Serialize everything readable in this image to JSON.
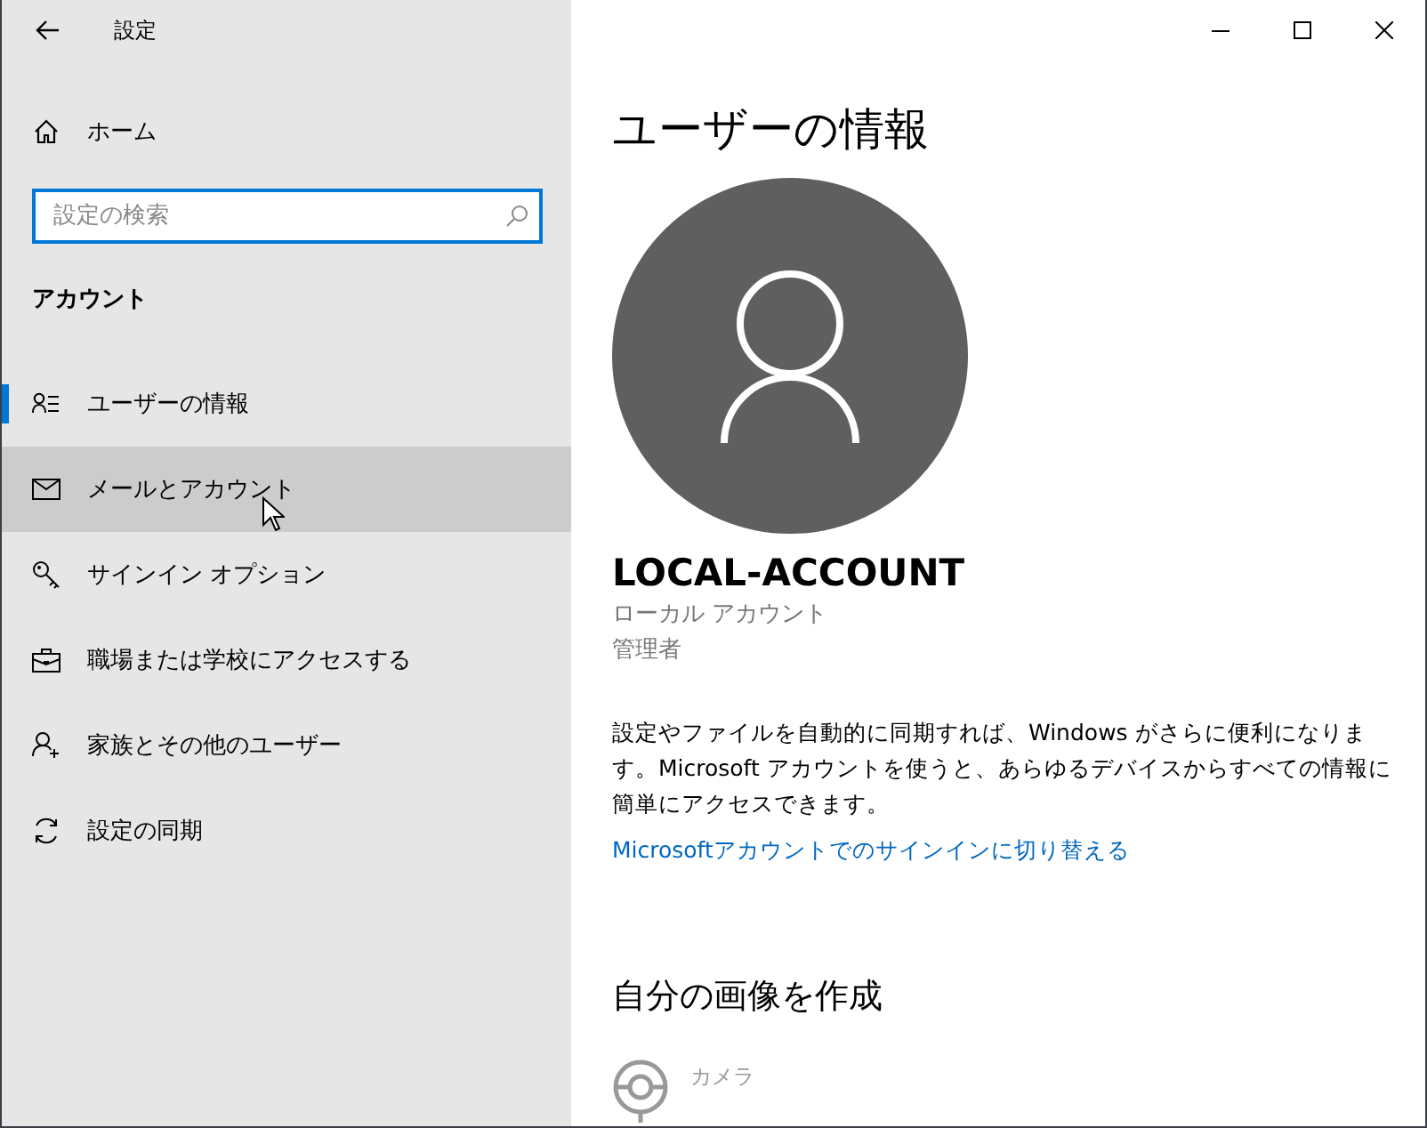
{
  "window": {
    "title": "設定"
  },
  "sidebar": {
    "home": "ホーム",
    "search": {
      "placeholder": "設定の検索"
    },
    "section": "アカウント",
    "items": [
      {
        "label": "ユーザーの情報",
        "kind": "user-list",
        "selected": true,
        "hovered": false
      },
      {
        "label": "メールとアカウント",
        "kind": "mail",
        "selected": false,
        "hovered": true
      },
      {
        "label": "サインイン オプション",
        "kind": "key",
        "selected": false,
        "hovered": false
      },
      {
        "label": "職場または学校にアクセスする",
        "kind": "briefcase",
        "selected": false,
        "hovered": false
      },
      {
        "label": "家族とその他のユーザー",
        "kind": "user-add",
        "selected": false,
        "hovered": false
      },
      {
        "label": "設定の同期",
        "kind": "sync",
        "selected": false,
        "hovered": false
      }
    ]
  },
  "main": {
    "heading": "ユーザーの情報",
    "account_name": "LOCAL-ACCOUNT",
    "account_type": "ローカル アカウント",
    "role": "管理者",
    "description": "設定やファイルを自動的に同期すれば、Windows がさらに便利になります。Microsoft アカウントを使うと、あらゆるデバイスからすべての情報に簡単にアクセスできます。",
    "link": "Microsoftアカウントでのサインインに切り替える",
    "create_heading": "自分の画像を作成",
    "options": [
      {
        "label": "カメラ",
        "disabled": true
      }
    ]
  }
}
